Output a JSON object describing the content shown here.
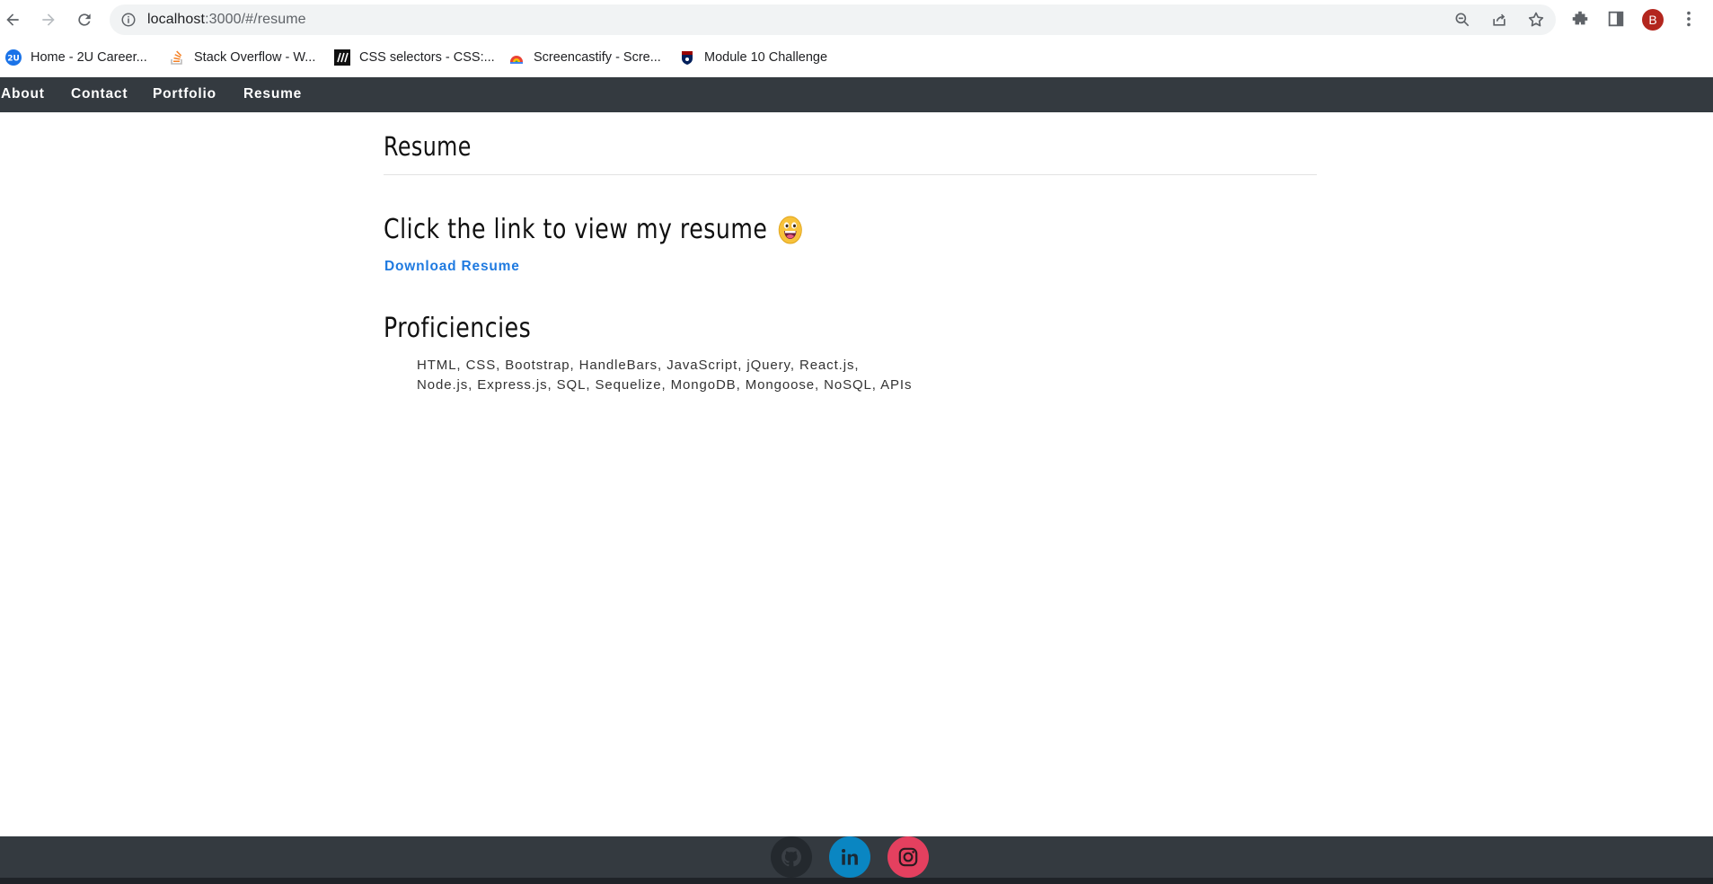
{
  "browser": {
    "url_host": "localhost",
    "url_path": ":3000/#/resume",
    "nav_icons": [
      "back-arrow-icon",
      "forward-arrow-icon",
      "reload-icon"
    ],
    "omnibox_icons": [
      "zoom-icon",
      "share-icon",
      "star-icon"
    ],
    "toolbar_icons": [
      "extensions-icon",
      "side-panel-icon",
      "kebab-menu-icon"
    ],
    "avatar_letter": "B",
    "avatar_color": "#b3261e"
  },
  "bookmarks": [
    {
      "label": "Home - 2U Career...",
      "icon": "2u-icon"
    },
    {
      "label": "Stack Overflow - W...",
      "icon": "stackoverflow-icon"
    },
    {
      "label": "CSS selectors - CSS:...",
      "icon": "mdn-icon"
    },
    {
      "label": "Screencastify - Scre...",
      "icon": "screencastify-icon"
    },
    {
      "label": "Module 10 Challenge",
      "icon": "penn-icon"
    }
  ],
  "navbar": {
    "items": [
      {
        "label": "About"
      },
      {
        "label": "Contact"
      },
      {
        "label": "Portfolio"
      },
      {
        "label": "Resume"
      }
    ],
    "background": "#343a40"
  },
  "page": {
    "title": "Resume",
    "resume_heading": "Click the link to view my resume",
    "download_link": "Download Resume",
    "proficiencies_heading": "Proficiencies",
    "proficiencies_line1": "HTML, CSS, Bootstrap, HandleBars, JavaScript, jQuery, React.js,",
    "proficiencies_line2": "Node.js, Express.js, SQL, Sequelize, MongoDB, Mongoose, NoSQL, APIs",
    "link_color": "#1f7ae0"
  },
  "footer": {
    "social": [
      {
        "icon": "github-icon",
        "color": "#24292e"
      },
      {
        "icon": "linkedin-icon",
        "color": "#0a86c2"
      },
      {
        "icon": "instagram-icon",
        "color": "#e4405f"
      }
    ]
  }
}
